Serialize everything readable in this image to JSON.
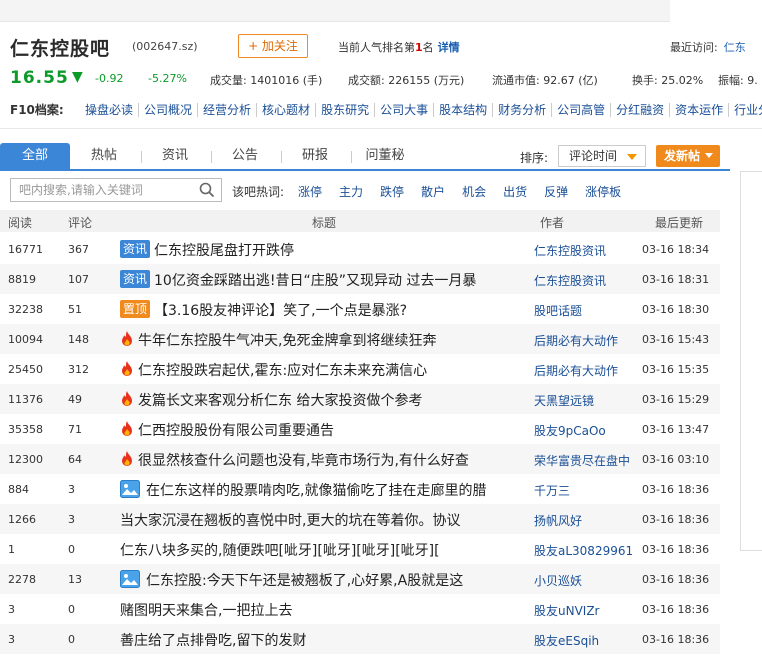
{
  "header": {
    "stock_name": "仁东控股吧",
    "stock_code": "(002647.sz)",
    "follow_label": "+ 加关注",
    "rank_prefix": "当前人气排名第",
    "rank_num": "1",
    "rank_suffix": "名",
    "detail_link": "详情",
    "recent_label": "最近访问:",
    "recent_item": "仁东"
  },
  "quote": {
    "price": "16.55",
    "change": "-0.92",
    "change_pct": "-5.27%",
    "volume": "成交量: 1401016 (手)",
    "amount": "成交额: 226155 (万元)",
    "float_cap": "流通市值: 92.67 (亿)",
    "turnover": "换手: 25.02%",
    "amplitude": "振幅: 9."
  },
  "f10": {
    "label": "F10档案:",
    "links": [
      "操盘必读",
      "公司概况",
      "经营分析",
      "核心题材",
      "股东研究",
      "公司大事",
      "股本结构",
      "财务分析",
      "公司高管",
      "分红融资",
      "资本运作",
      "行业分"
    ]
  },
  "tabs": [
    "全部",
    "热帖",
    "资讯",
    "公告",
    "研报",
    "问董秘"
  ],
  "sort": {
    "label": "排序:",
    "selected": "评论时间"
  },
  "post_button": "发新帖",
  "search": {
    "placeholder": "吧内搜索,请输入关键词"
  },
  "hot": {
    "label": "该吧热词:",
    "words": [
      "涨停",
      "主力",
      "跌停",
      "散户",
      "机会",
      "出货",
      "反弹",
      "涨停板"
    ]
  },
  "table": {
    "headers": {
      "read": "阅读",
      "comment": "评论",
      "title": "标题",
      "author": "作者",
      "updated": "最后更新"
    },
    "rows": [
      {
        "read": "16771",
        "comment": "367",
        "tag": "资讯",
        "tag_type": "news",
        "title": "仁东控股尾盘打开跌停",
        "author": "仁东控股资讯",
        "time": "03-16 18:34"
      },
      {
        "read": "8819",
        "comment": "107",
        "tag": "资讯",
        "tag_type": "news",
        "title": "10亿资金踩踏出逃!昔日“庄股”又现异动 过去一月暴",
        "author": "仁东控股资讯",
        "time": "03-16 18:31"
      },
      {
        "read": "32238",
        "comment": "51",
        "tag": "置顶",
        "tag_type": "top",
        "title": "【3.16股友神评论】笑了,一个点是暴涨?",
        "author": "股吧话题",
        "time": "03-16 18:30"
      },
      {
        "read": "10094",
        "comment": "148",
        "tag": "",
        "tag_type": "fire",
        "title": "牛年仁东控股牛气冲天,免死金牌拿到将继续狂奔",
        "author": "后期必有大动作",
        "time": "03-16 15:43"
      },
      {
        "read": "25450",
        "comment": "312",
        "tag": "",
        "tag_type": "fire",
        "title": "仁东控股跌宕起伏,霍东:应对仁东未来充满信心",
        "author": "后期必有大动作",
        "time": "03-16 15:35"
      },
      {
        "read": "11376",
        "comment": "49",
        "tag": "",
        "tag_type": "fire",
        "title": "发篇长文来客观分析仁东 给大家投资做个参考",
        "author": "天黑望远镜",
        "time": "03-16 15:29"
      },
      {
        "read": "35358",
        "comment": "71",
        "tag": "",
        "tag_type": "fire",
        "title": "仁西控股股份有限公司重要通告",
        "author": "股友9pCaOo",
        "time": "03-16 13:47"
      },
      {
        "read": "12300",
        "comment": "64",
        "tag": "",
        "tag_type": "fire",
        "title": "很显然核查什么问题也没有,毕竟市场行为,有什么好查",
        "author": "荣华富贵尽在盘中",
        "time": "03-16 03:10"
      },
      {
        "read": "884",
        "comment": "3",
        "tag": "",
        "tag_type": "pic",
        "title": "在仁东这样的股票啃肉吃,就像猫偷吃了挂在走廊里的腊",
        "author": "千万三",
        "time": "03-16 18:36"
      },
      {
        "read": "1266",
        "comment": "3",
        "tag": "",
        "tag_type": "none",
        "title": "当大家沉浸在翘板的喜悦中时,更大的坑在等着你。协议",
        "author": "扬帆风好",
        "time": "03-16 18:36"
      },
      {
        "read": "1",
        "comment": "0",
        "tag": "",
        "tag_type": "none",
        "title": "仁东八块多买的,随便跌吧[呲牙][呲牙][呲牙][呲牙][",
        "author": "股友aL30829961",
        "time": "03-16 18:36"
      },
      {
        "read": "2278",
        "comment": "13",
        "tag": "",
        "tag_type": "pic",
        "title": "仁东控股:今天下午还是被翘板了,心好累,A股就是这",
        "author": "小贝巡妖",
        "time": "03-16 18:36"
      },
      {
        "read": "3",
        "comment": "0",
        "tag": "",
        "tag_type": "none",
        "title": "赌图明天来集合,一把拉上去",
        "author": "股友uNVIZr",
        "time": "03-16 18:36"
      },
      {
        "read": "3",
        "comment": "0",
        "tag": "",
        "tag_type": "none",
        "title": "善庄给了点排骨吃,留下的发财",
        "author": "股友eESqih",
        "time": "03-16 18:36"
      }
    ]
  },
  "colors": {
    "accent": "#3b86d6",
    "orange": "#f08a1c",
    "green": "#0c9a28",
    "link": "#1a4f96"
  }
}
